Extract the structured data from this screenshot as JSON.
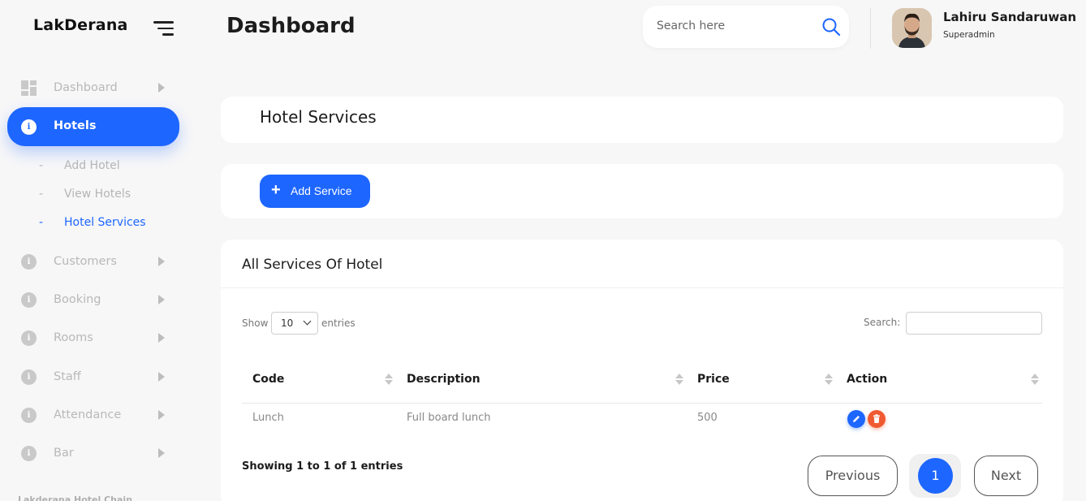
{
  "brand": "LakDerana",
  "header": {
    "title": "Dashboard",
    "search_placeholder": "Search here",
    "user_name": "Lahiru Sandaruwan",
    "user_role": "Superadmin"
  },
  "sidebar": {
    "items": [
      {
        "label": "Dashboard",
        "icon": "grid-icon"
      },
      {
        "label": "Hotels",
        "icon": "info-circle-icon",
        "active": true
      },
      {
        "label": "Customers",
        "icon": "info-circle-icon"
      },
      {
        "label": "Booking",
        "icon": "info-circle-icon"
      },
      {
        "label": "Rooms",
        "icon": "info-circle-icon"
      },
      {
        "label": "Staff",
        "icon": "info-circle-icon"
      },
      {
        "label": "Attendance",
        "icon": "info-circle-icon"
      },
      {
        "label": "Bar",
        "icon": "info-circle-icon"
      }
    ],
    "sub_items": [
      {
        "label": "Add Hotel"
      },
      {
        "label": "View Hotels"
      },
      {
        "label": "Hotel Services",
        "active": true
      }
    ],
    "dash": "-",
    "footer": "Lakderana Hotel Chain"
  },
  "main": {
    "section_title": "Hotel Services",
    "add_button": "Add Service",
    "add_icon": "+",
    "table_title": "All Services Of Hotel",
    "show_label": "Show",
    "entries_value": "10",
    "entries_label": "entries",
    "search_label": "Search:",
    "columns": [
      "Code",
      "Description",
      "Price",
      "Action"
    ],
    "rows": [
      {
        "code": "Lunch",
        "description": "Full board lunch",
        "price": "500"
      }
    ],
    "showing": "Showing 1 to 1 of 1 entries",
    "pagination": {
      "previous": "Previous",
      "current": "1",
      "next": "Next"
    }
  },
  "colors": {
    "accent": "#1d66ff",
    "danger": "#f05a32",
    "muted": "#b8b8b8"
  }
}
